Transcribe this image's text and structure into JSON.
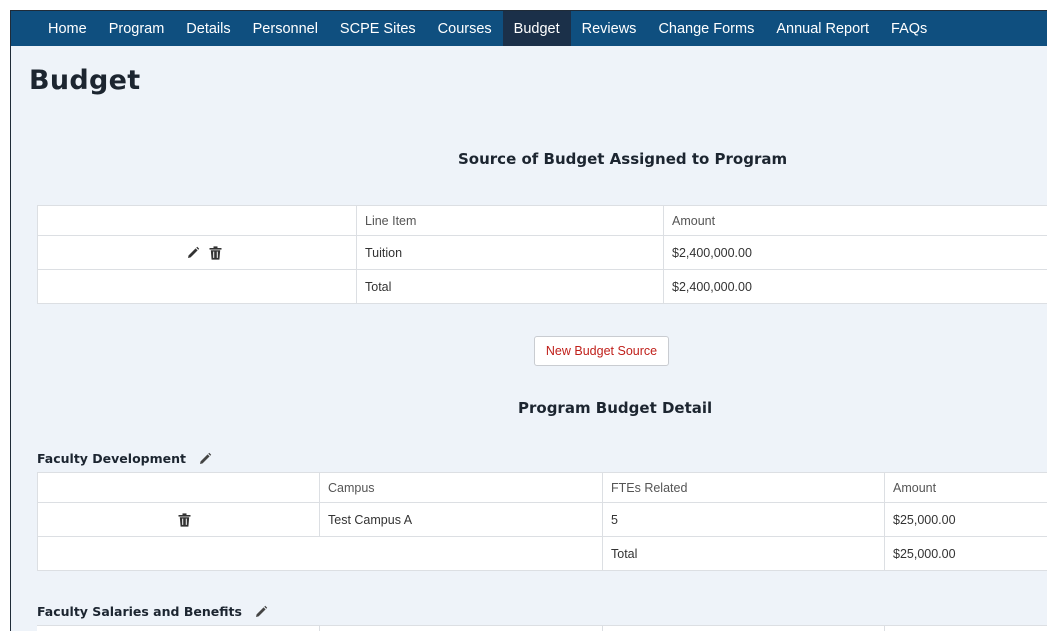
{
  "nav": {
    "items": [
      "Home",
      "Program",
      "Details",
      "Personnel",
      "SCPE Sites",
      "Courses",
      "Budget",
      "Reviews",
      "Change Forms",
      "Annual Report",
      "FAQs"
    ],
    "active": "Budget"
  },
  "page": {
    "title": "Budget"
  },
  "source": {
    "title": "Source of Budget Assigned to Program",
    "headers": {
      "line_item": "Line Item",
      "amount": "Amount"
    },
    "rows": [
      {
        "line_item": "Tuition",
        "amount": "$2,400,000.00"
      }
    ],
    "total": {
      "label": "Total",
      "amount": "$2,400,000.00"
    },
    "new_button": "New Budget Source"
  },
  "detail": {
    "title": "Program Budget Detail",
    "groups": [
      {
        "name": "Faculty Development",
        "headers": {
          "campus": "Campus",
          "ftes": "FTEs Related",
          "amount": "Amount"
        },
        "rows": [
          {
            "campus": "Test Campus A",
            "ftes": "5",
            "amount": "$25,000.00"
          }
        ],
        "total": {
          "label": "Total",
          "amount": "$25,000.00"
        }
      },
      {
        "name": "Faculty Salaries and Benefits"
      }
    ]
  },
  "colors": {
    "navbar": "#0f4f7f",
    "nav_active": "#1b3049",
    "page_bg": "#eef3f9",
    "button_text": "#c0201b"
  },
  "icons": [
    "edit-pencil-icon",
    "trash-icon"
  ]
}
